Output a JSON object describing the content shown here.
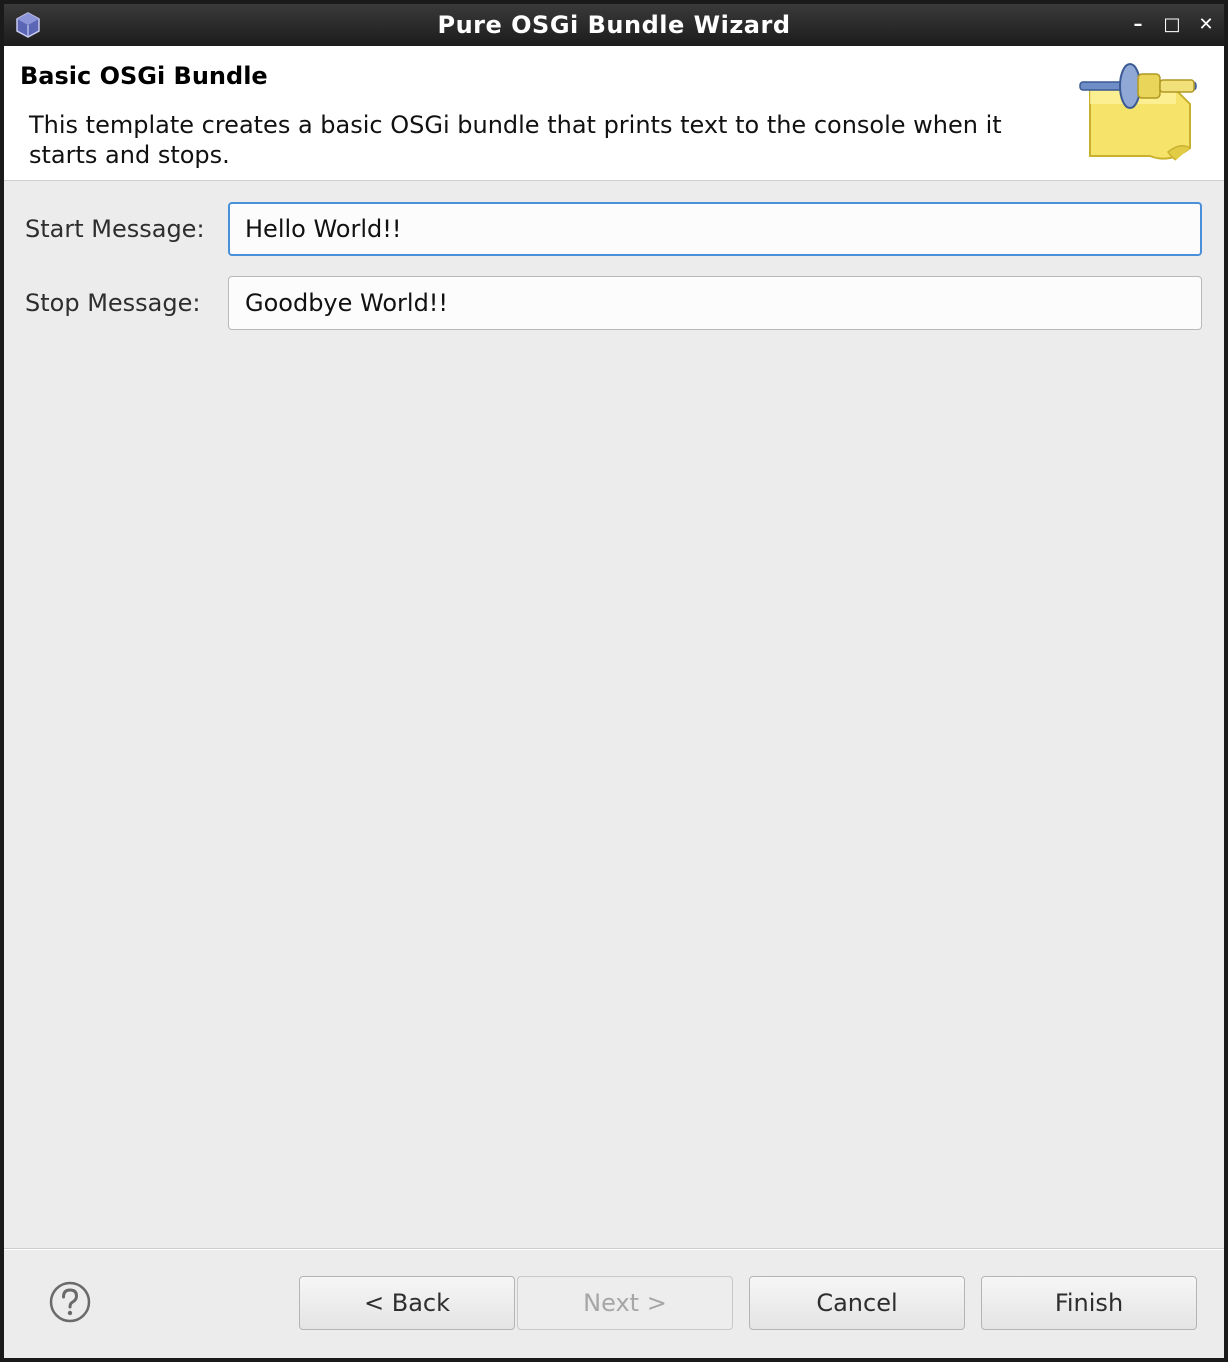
{
  "window": {
    "title": "Pure OSGi Bundle Wizard",
    "minimize_glyph": "–",
    "maximize_glyph": "□",
    "close_glyph": "✕"
  },
  "banner": {
    "title": "Basic OSGi Bundle",
    "description": "This template creates a basic OSGi bundle that prints text to the console when it starts and stops."
  },
  "form": {
    "start_label": "Start Message:",
    "start_value": "Hello World!!",
    "stop_label": "Stop Message:",
    "stop_value": "Goodbye World!!"
  },
  "buttons": {
    "back": "< Back",
    "next": "Next >",
    "cancel": "Cancel",
    "finish": "Finish"
  },
  "state": {
    "next_enabled": false,
    "focused_field": "start"
  },
  "icons": {
    "app": "eclipse-cube-icon",
    "banner": "plugin-wizard-icon",
    "help": "help-icon"
  },
  "colors": {
    "titlebar": "#262626",
    "focus": "#4a90d9",
    "dialog_bg": "#ececec"
  }
}
